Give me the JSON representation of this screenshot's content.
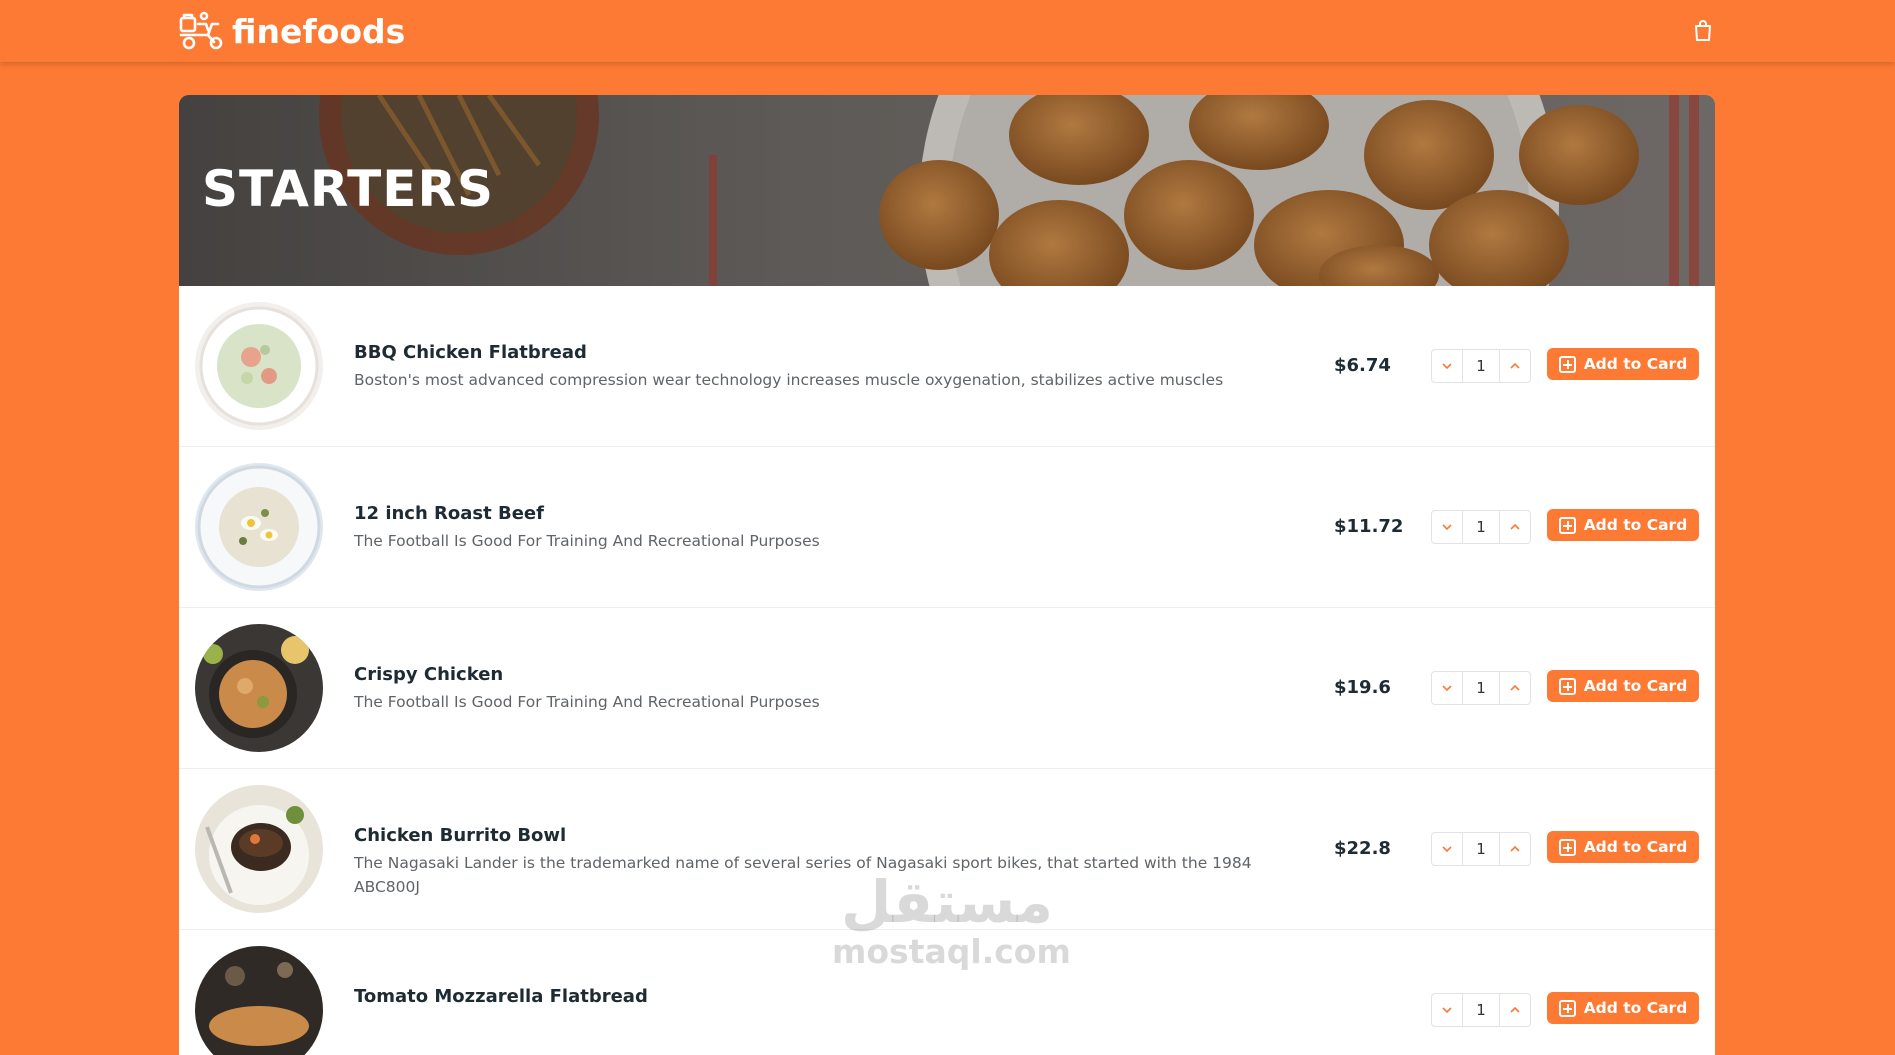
{
  "header": {
    "brand": "finefoods",
    "logo_icon": "delivery-scooter-icon",
    "cart_icon": "shopping-bag-icon"
  },
  "section": {
    "title": "STARTERS"
  },
  "items": [
    {
      "name": "BBQ Chicken Flatbread",
      "description": "Boston's most advanced compression wear technology increases muscle oxygenation, stabilizes active muscles",
      "price": "$6.74",
      "quantity": "1",
      "button_label": "Add to Card"
    },
    {
      "name": "12 inch Roast Beef",
      "description": "The Football Is Good For Training And Recreational Purposes",
      "price": "$11.72",
      "quantity": "1",
      "button_label": "Add to Card"
    },
    {
      "name": "Crispy Chicken",
      "description": "The Football Is Good For Training And Recreational Purposes",
      "price": "$19.6",
      "quantity": "1",
      "button_label": "Add to Card"
    },
    {
      "name": "Chicken Burrito Bowl",
      "description": "The Nagasaki Lander is the trademarked name of several series of Nagasaki sport bikes, that started with the 1984 ABC800J",
      "price": "$22.8",
      "quantity": "1",
      "button_label": "Add to Card"
    },
    {
      "name": "Tomato Mozzarella Flatbread",
      "description": "",
      "price": "",
      "quantity": "1",
      "button_label": "Add to Card"
    }
  ],
  "watermark": {
    "arabic": "مستقل",
    "latin": "mostaql.com"
  },
  "colors": {
    "accent": "#fd7a34",
    "text_dark": "#1e2b33",
    "text_muted": "#5f6468"
  }
}
